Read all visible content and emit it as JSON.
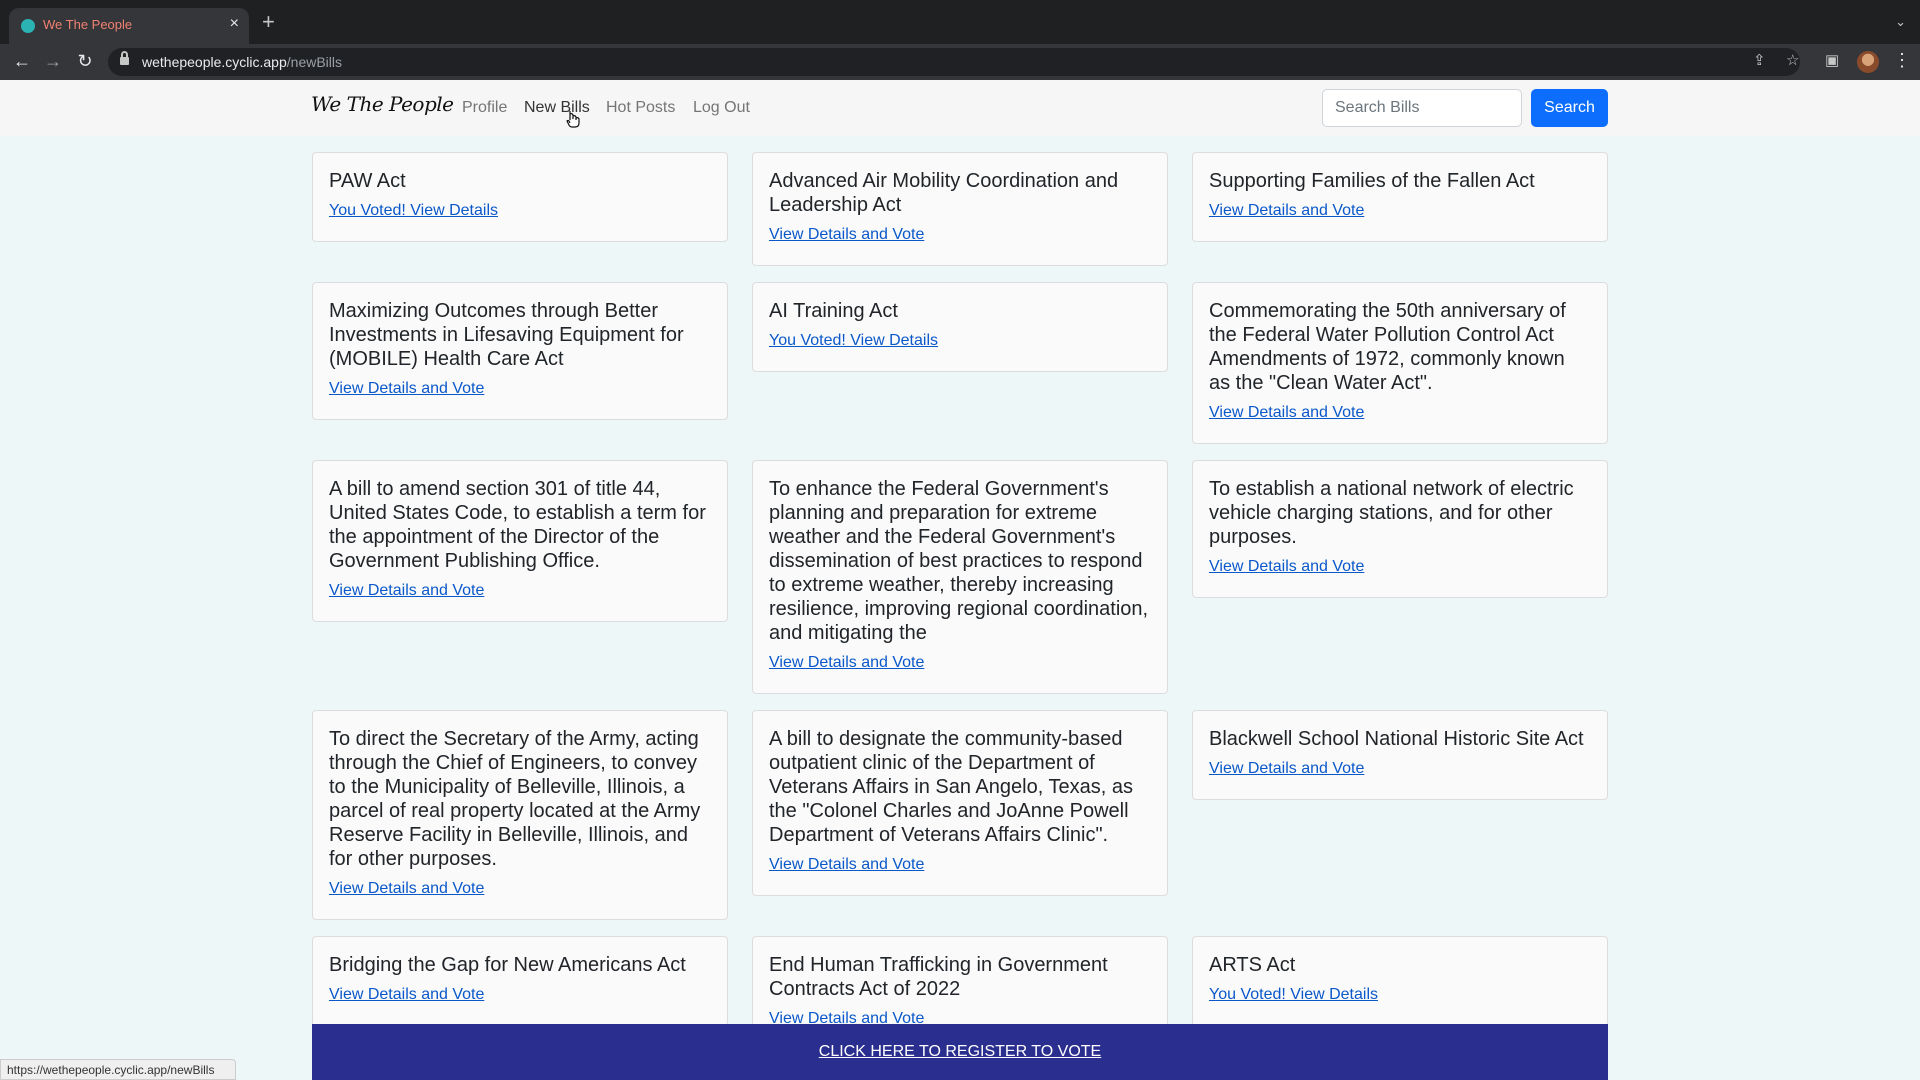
{
  "browser": {
    "tab_title": "We The People",
    "tab_close": "×",
    "new_tab": "+",
    "tab_search": "⌄",
    "url_host": "wethepeople.cyclic.app",
    "url_path": "/newBills",
    "status_url": "https://wethepeople.cyclic.app/newBills",
    "icons": [
      "back-icon",
      "forward-icon",
      "reload-icon",
      "lock-icon",
      "share-icon",
      "bookmark-star-icon",
      "side-panel-icon",
      "profile-avatar",
      "menu-icon"
    ]
  },
  "navbar": {
    "brand": "We The People",
    "links": [
      "Profile",
      "New Bills",
      "Hot Posts",
      "Log Out"
    ],
    "active_link": "New Bills",
    "search_placeholder": "Search Bills",
    "search_button": "Search"
  },
  "bills": [
    {
      "title": "PAW Act",
      "link": "You Voted! View Details"
    },
    {
      "title": "Advanced Air Mobility Coordination and Leadership Act",
      "link": "View Details and Vote"
    },
    {
      "title": "Supporting Families of the Fallen Act",
      "link": "View Details and Vote"
    },
    {
      "title": "Maximizing Outcomes through Better Investments in Lifesaving Equipment for (MOBILE) Health Care Act",
      "link": "View Details and Vote"
    },
    {
      "title": "AI Training Act",
      "link": "You Voted! View Details"
    },
    {
      "title": "Commemorating the 50th anniversary of the Federal Water Pollution Control Act Amendments of 1972, commonly known as the \"Clean Water Act\".",
      "link": "View Details and Vote"
    },
    {
      "title": "A bill to amend section 301 of title 44, United States Code, to establish a term for the appointment of the Director of the Government Publishing Office.",
      "link": "View Details and Vote"
    },
    {
      "title": "To enhance the Federal Government's planning and preparation for extreme weather and the Federal Government's dissemination of best practices to respond to extreme weather, thereby increasing resilience, improving regional coordination, and mitigating the",
      "link": "View Details and Vote"
    },
    {
      "title": "To establish a national network of electric vehicle charging stations, and for other purposes.",
      "link": "View Details and Vote"
    },
    {
      "title": "To direct the Secretary of the Army, acting through the Chief of Engineers, to convey to the Municipality of Belleville, Illinois, a parcel of real property located at the Army Reserve Facility in Belleville, Illinois, and for other purposes.",
      "link": "View Details and Vote"
    },
    {
      "title": "A bill to designate the community-based outpatient clinic of the Department of Veterans Affairs in San Angelo, Texas, as the \"Colonel Charles and JoAnne Powell Department of Veterans Affairs Clinic\".",
      "link": "View Details and Vote"
    },
    {
      "title": "Blackwell School National Historic Site Act",
      "link": "View Details and Vote"
    },
    {
      "title": "Bridging the Gap for New Americans Act",
      "link": "View Details and Vote"
    },
    {
      "title": "End Human Trafficking in Government Contracts Act of 2022",
      "link": "View Details and Vote"
    },
    {
      "title": "ARTS Act",
      "link": "You Voted! View Details"
    }
  ],
  "banner": {
    "text": "CLICK HERE TO REGISTER TO VOTE",
    "color": "#2a2f8f"
  },
  "colors": {
    "accent": "#0d6efd",
    "link": "#0a58ca"
  }
}
